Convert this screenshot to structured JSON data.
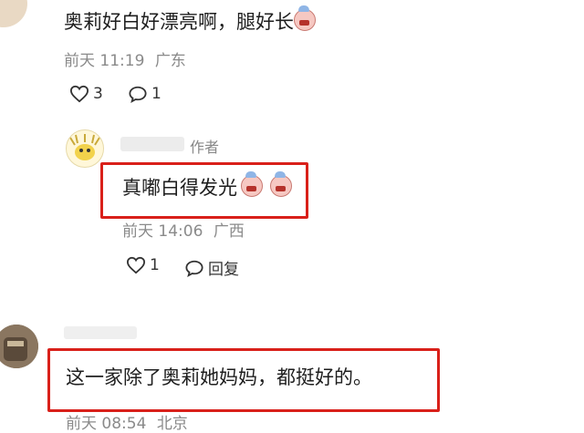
{
  "comment1": {
    "text": "奥莉好白好漂亮啊，腿好长",
    "emoji_icon": "crying-laugh-emoji",
    "time": "前天 11:19",
    "location": "广东",
    "like_count": "3",
    "reply_count": "1"
  },
  "reply": {
    "author_tag": "作者",
    "text": "真嘟白得发光",
    "emoji_icons": [
      "crying-laugh-emoji",
      "crying-laugh-emoji"
    ],
    "time": "前天 14:06",
    "location": "广西",
    "like_count": "1",
    "reply_label": "回复"
  },
  "comment3": {
    "text": "这一家除了奥莉她妈妈，都挺好的。",
    "time": "前天 08:54",
    "location": "北京"
  },
  "colors": {
    "highlight": "#d9201a",
    "meta_text": "#8a8a8a"
  }
}
